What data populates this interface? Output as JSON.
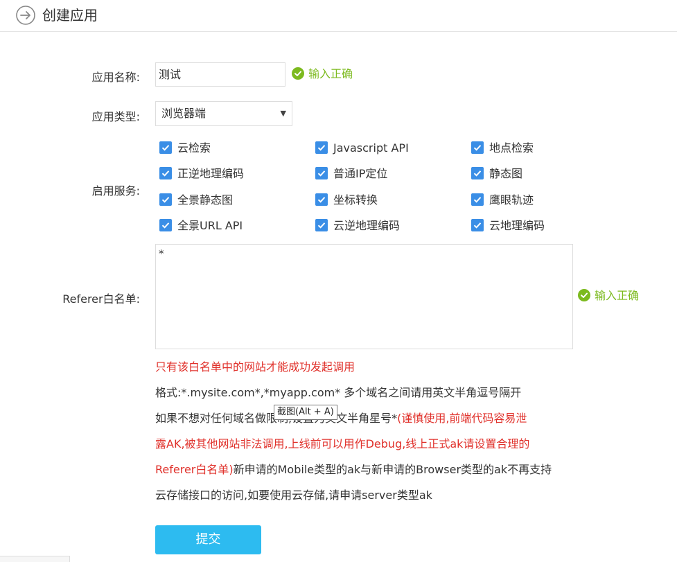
{
  "header": {
    "title": "创建应用",
    "back_icon": "circle-arrow-right-icon"
  },
  "form": {
    "name": {
      "label": "应用名称:",
      "value": "测试",
      "status": "输入正确"
    },
    "type": {
      "label": "应用类型:",
      "selected": "浏览器端"
    },
    "services": {
      "label": "启用服务:",
      "items": [
        {
          "label": "云检索",
          "checked": true
        },
        {
          "label": "Javascript API",
          "checked": true
        },
        {
          "label": "地点检索",
          "checked": true
        },
        {
          "label": "正逆地理编码",
          "checked": true
        },
        {
          "label": "普通IP定位",
          "checked": true
        },
        {
          "label": "静态图",
          "checked": true
        },
        {
          "label": "全景静态图",
          "checked": true
        },
        {
          "label": "坐标转换",
          "checked": true
        },
        {
          "label": "鹰眼轨迹",
          "checked": true
        },
        {
          "label": "全景URL API",
          "checked": true
        },
        {
          "label": "云逆地理编码",
          "checked": true
        },
        {
          "label": "云地理编码",
          "checked": true
        }
      ]
    },
    "referer": {
      "label": "Referer白名单:",
      "value": "*",
      "status": "输入正确"
    }
  },
  "notes": {
    "warning": "只有该白名单中的网站才能成功发起调用",
    "format": "格式:*.mysite.com*,*myapp.com* 多个域名之间请用英文半角逗号隔开",
    "line3_black": "如果不想对任何域名做限制,设置为英文半角星号*",
    "line3_red": "(谨慎使用,前端代码容易泄",
    "line4_red": "露AK,被其他网站非法调用,上线前可以用作Debug,线上正式ak请设置合理的",
    "line5_red": "Referer白名单)",
    "line5_black": "新申请的Mobile类型的ak与新申请的Browser类型的ak不再支持",
    "line6": "云存储接口的访问,如要使用云存储,请申请server类型ak"
  },
  "tooltip": "截图(Alt + A)",
  "submit_label": "提交",
  "colors": {
    "accent": "#2dbbf0",
    "success": "#7cba1e",
    "warning": "#e0302a",
    "checkbox": "#3a8ee6"
  }
}
